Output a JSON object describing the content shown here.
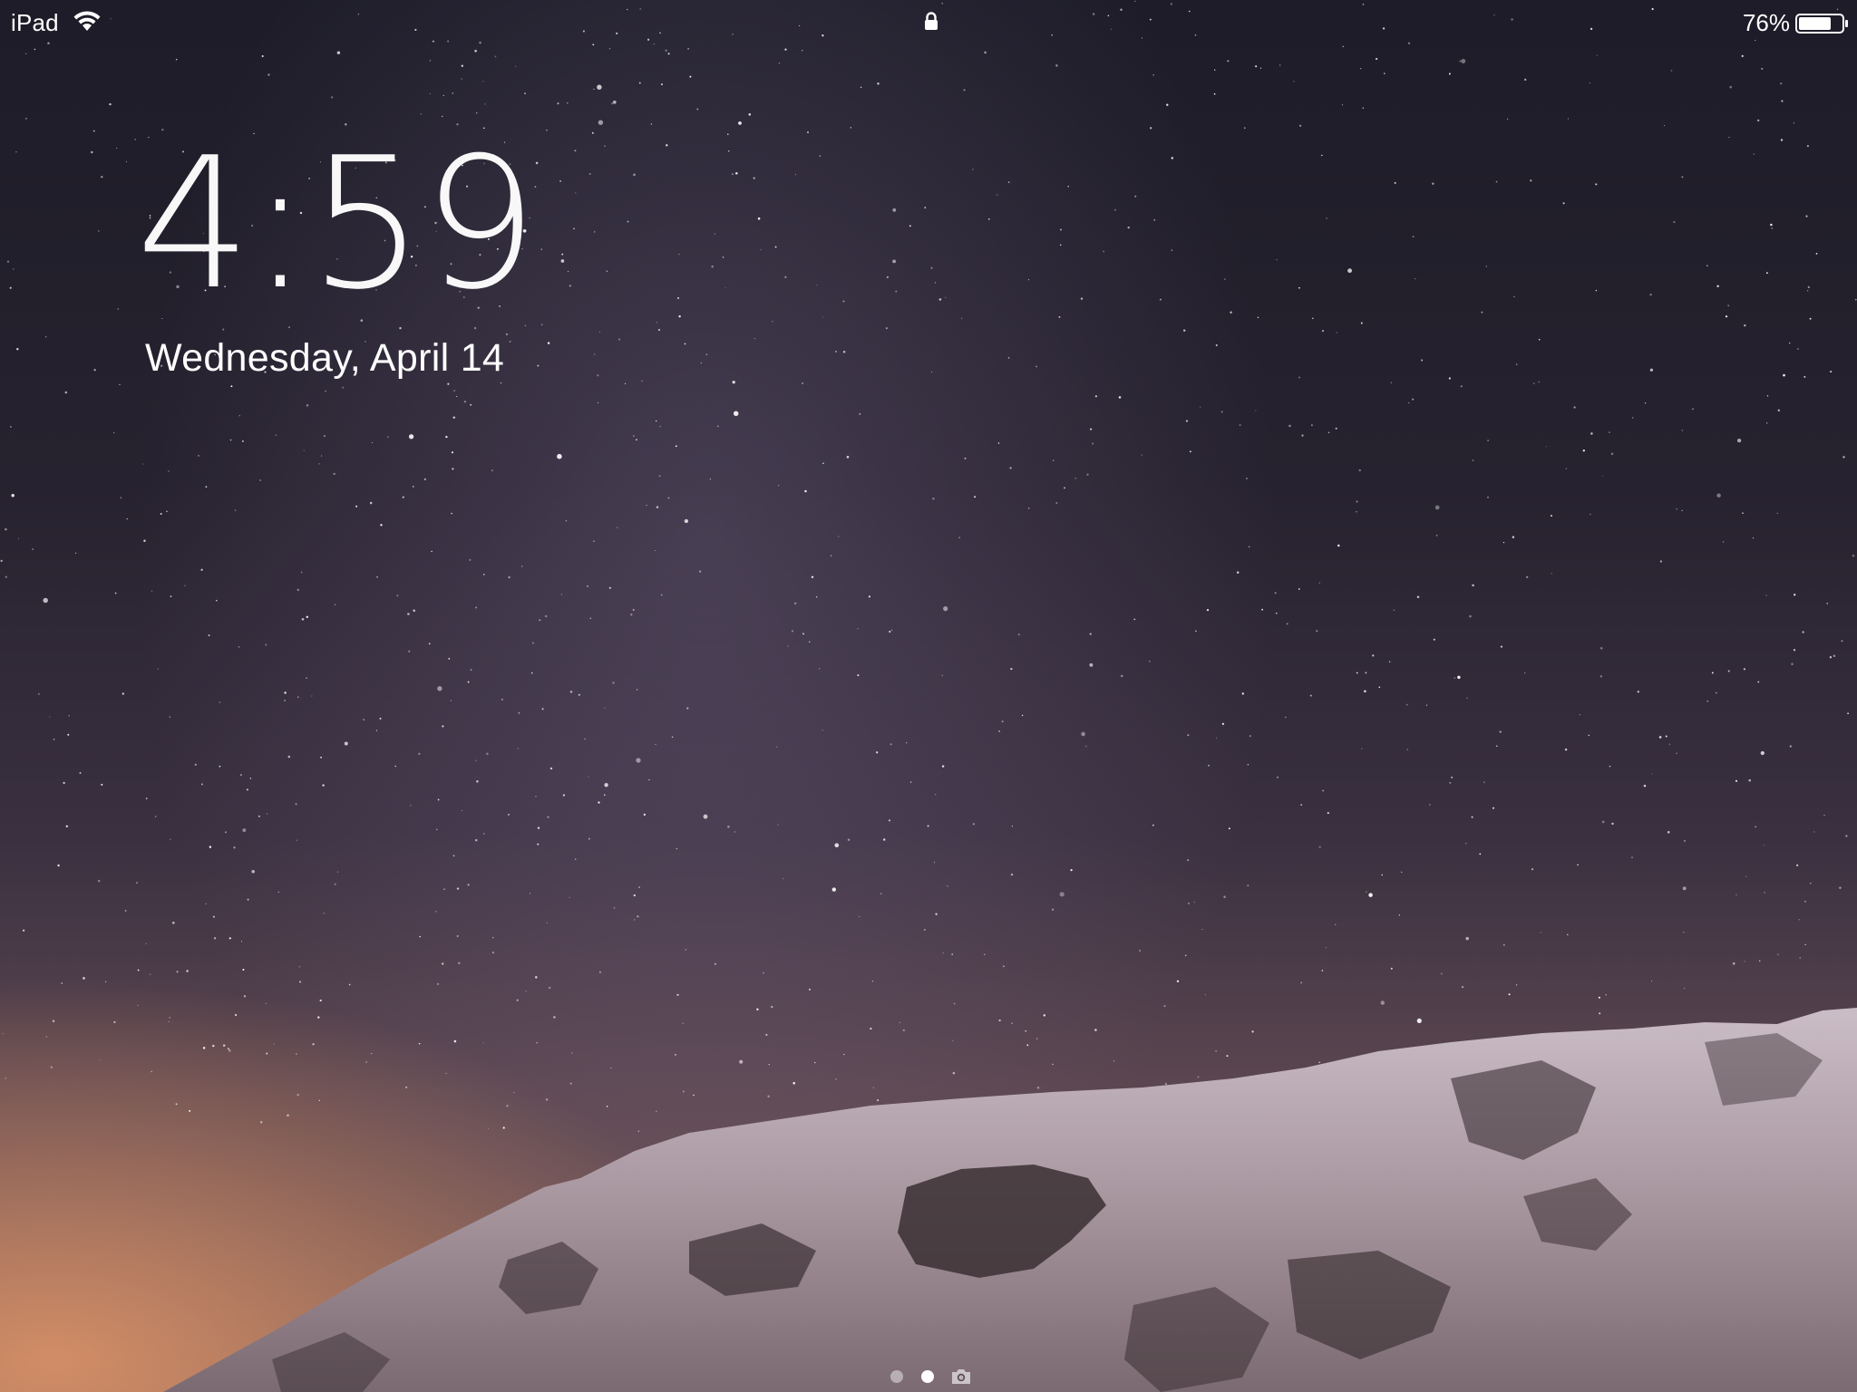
{
  "status_bar": {
    "carrier": "iPad",
    "battery_percent": "76%",
    "battery_level": 0.76,
    "icons": [
      "wifi-icon",
      "lock-icon",
      "battery-icon"
    ]
  },
  "lock_screen": {
    "time": "4:59",
    "date": "Wednesday, April 14"
  },
  "page_indicator": {
    "pages": 2,
    "current_page": 2,
    "trailing_icon": "camera-icon"
  },
  "wallpaper": {
    "description_icons": [],
    "colors": {
      "sky_top": "#1d1c28",
      "sky_glow": "#e0966a",
      "snow": "#d8cdd2",
      "rock": "#2d2628"
    }
  }
}
